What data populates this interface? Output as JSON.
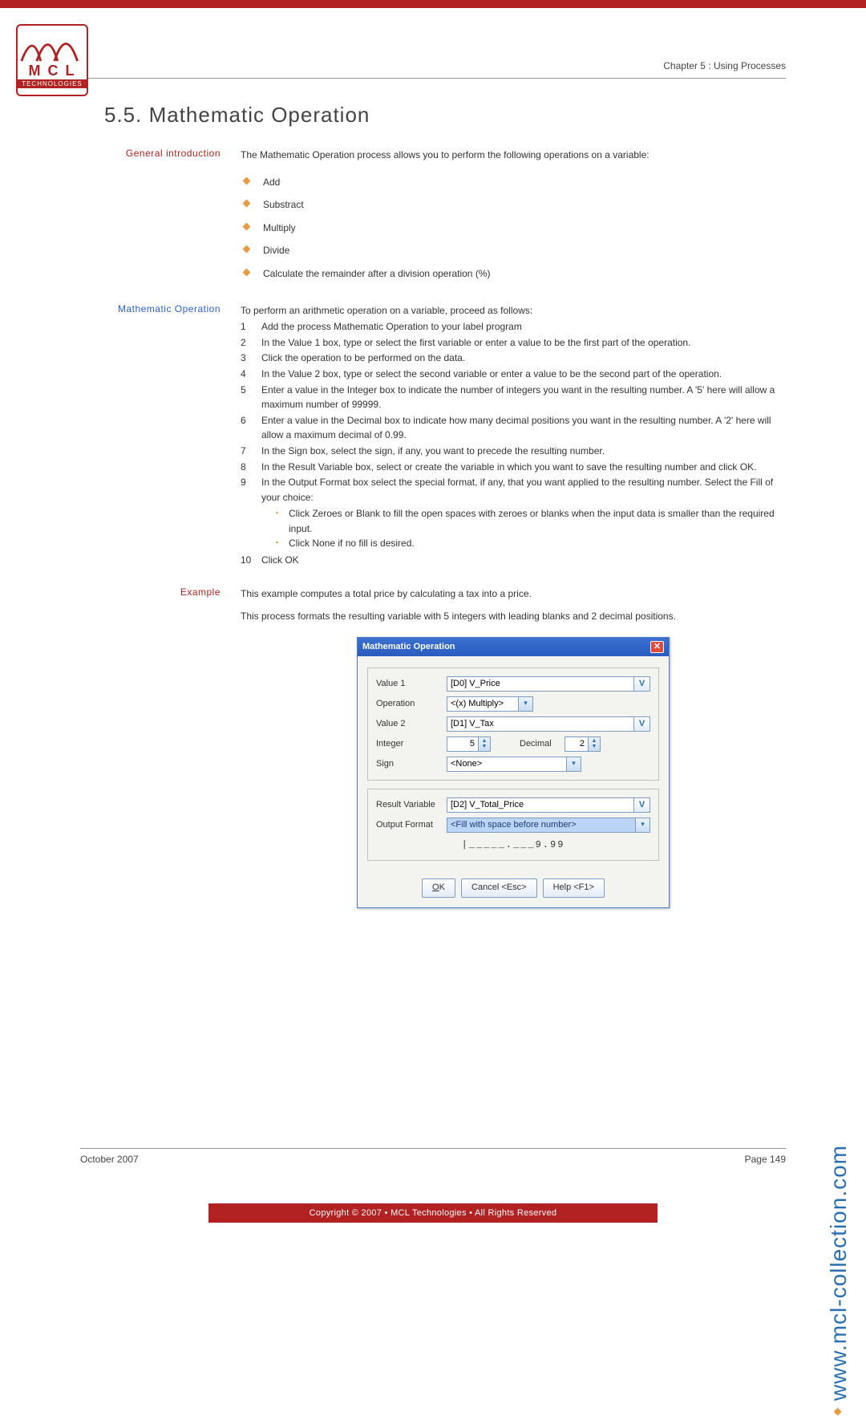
{
  "logo": {
    "line1": "M C L",
    "line2": "TECHNOLOGIES"
  },
  "chapter": "Chapter 5 : Using Processes",
  "heading": "5.5. Mathematic Operation",
  "intro": {
    "label": "General introduction",
    "lead": "The Mathematic Operation process allows you to perform the following operations on a variable:",
    "bullets": [
      "Add",
      "Substract",
      "Multiply",
      "Divide",
      "Calculate the remainder after a division operation (%)"
    ]
  },
  "procedure": {
    "label": "Mathematic Operation",
    "lead": "To perform an arithmetic operation on a variable, proceed as follows:",
    "steps": [
      "Add the process Mathematic Operation to your label program",
      "In the Value 1 box, type or select the first variable or enter a value to be the first part of the operation.",
      "Click the operation to be performed on the data.",
      "In the Value 2 box, type or select the second variable or enter a value to be the second part of the operation.",
      "Enter a value in the Integer box to indicate the number of integers you want in the resulting number. A '5' here will allow a maximum number of 99999.",
      "Enter a value in the Decimal box to indicate how many decimal positions you want in the resulting number. A '2' here will allow a maximum decimal of 0.99.",
      "In the Sign box, select the sign, if any, you want to precede the resulting number.",
      "In the Result Variable box, select or create the variable in which you want to save the resulting number and click OK.",
      "In the Output Format box select the special format, if any, that you want applied to the resulting number.  Select the Fill of your choice:"
    ],
    "sub": [
      "Click Zeroes or Blank to fill the open spaces with zeroes or blanks when the input data is smaller than the required input.",
      "Click None if no fill is desired."
    ],
    "step10": "Click OK"
  },
  "example": {
    "label": "Example",
    "p1": "This example computes a total price by calculating a tax into a price.",
    "p2": "This process formats the resulting variable with 5 integers with leading blanks and 2 decimal positions."
  },
  "dialog": {
    "title": "Mathematic Operation",
    "labels": {
      "value1": "Value 1",
      "operation": "Operation",
      "value2": "Value 2",
      "integer": "Integer",
      "decimal": "Decimal",
      "sign": "Sign",
      "result": "Result Variable",
      "output": "Output Format"
    },
    "values": {
      "value1": "[D0] V_Price",
      "operation": "<(x) Multiply>",
      "value2": "[D1] V_Tax",
      "integer": "5",
      "decimal": "2",
      "sign": "<None>",
      "result": "[D2] V_Total_Price",
      "output": "<Fill with space before number>",
      "preview": "|_____.___9.99"
    },
    "buttons": {
      "ok": "OK",
      "cancel": "Cancel <Esc>",
      "help": "Help <F1>"
    }
  },
  "footer": {
    "left": "October 2007",
    "right": "Page 149"
  },
  "copyright": "Copyright © 2007 • MCL Technologies • All Rights Reserved",
  "side_url": "www.mcl-collection.com"
}
